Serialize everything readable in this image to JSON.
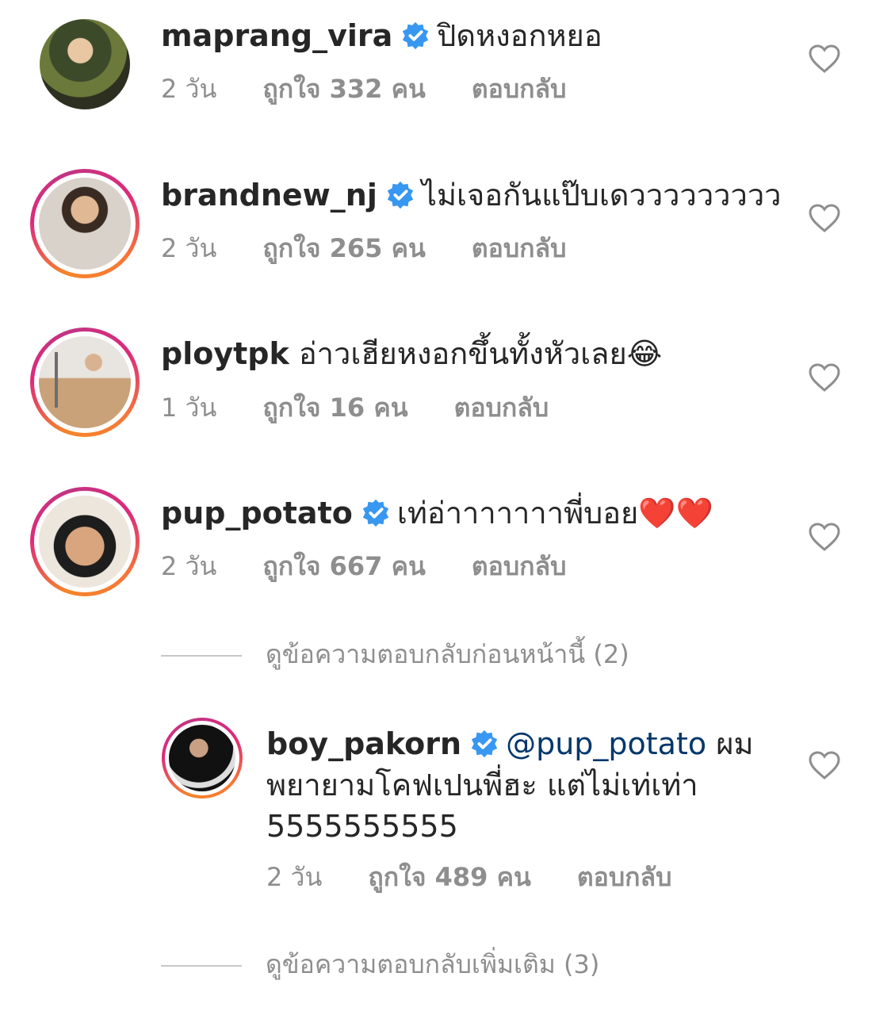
{
  "comments": [
    {
      "username": "maprang_vira",
      "verified": true,
      "text": "ปิดหงอกหยอ",
      "time": "2 วัน",
      "likes": "ถูกใจ 332 คน",
      "reply": "ตอบกลับ",
      "story_ring": false
    },
    {
      "username": "brandnew_nj",
      "verified": true,
      "text": "ไม่เจอกันแป๊บเดววววววววว",
      "time": "2 วัน",
      "likes": "ถูกใจ 265 คน",
      "reply": "ตอบกลับ",
      "story_ring": true
    },
    {
      "username": "ploytpk",
      "verified": false,
      "text": "อ่าวเฮียหงอกขึ้นทั้งหัวเลย😂",
      "time": "1 วัน",
      "likes": "ถูกใจ 16 คน",
      "reply": "ตอบกลับ",
      "story_ring": true
    },
    {
      "username": "pup_potato",
      "verified": true,
      "text": "เท่อ่าาาาาาาพี่บอย❤️❤️",
      "time": "2 วัน",
      "likes": "ถูกใจ 667 คน",
      "reply": "ตอบกลับ",
      "story_ring": true
    }
  ],
  "view_previous_replies": "ดูข้อความตอบกลับก่อนหน้านี้ (2)",
  "reply_comment": {
    "username": "boy_pakorn",
    "verified": true,
    "mention": "@pup_potato",
    "text": " ผมพยายามโคฟเปนพี่ฮะ แต่ไม่เท่เท่า 5555555555",
    "time": "2 วัน",
    "likes": "ถูกใจ 489 คน",
    "reply": "ตอบกลับ"
  },
  "view_more_replies": "ดูข้อความตอบกลับเพิ่มเติม (3)",
  "colors": {
    "verified": "#3897f0",
    "meta": "#8e8e8e",
    "mention": "#00376b",
    "ring_start": "#f58529",
    "ring_end": "#dd2a7b"
  }
}
